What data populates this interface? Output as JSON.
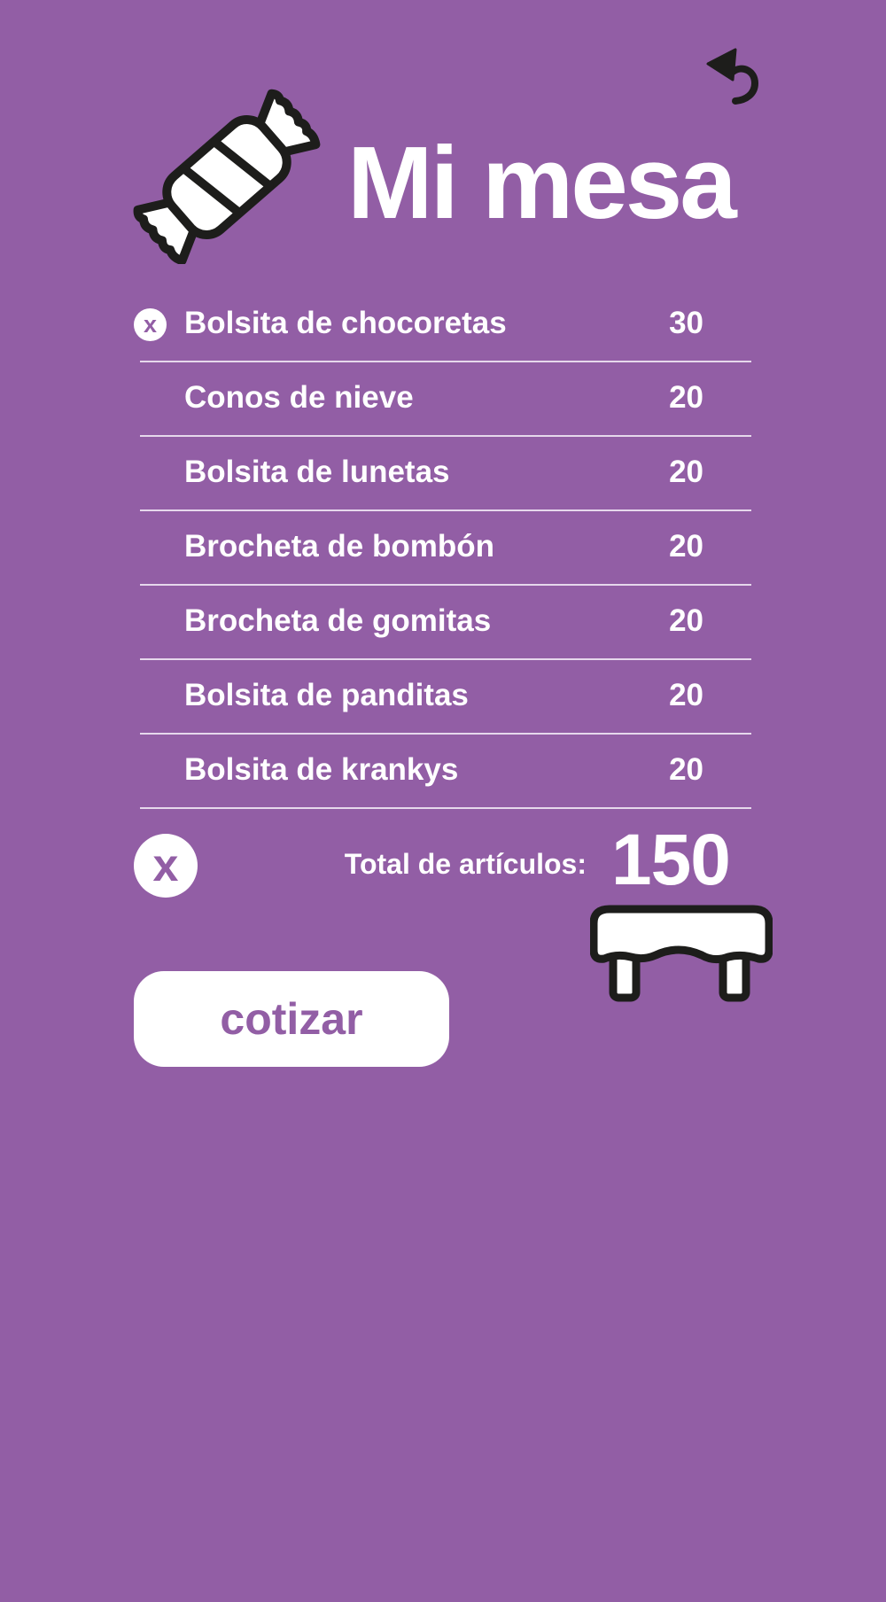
{
  "header": {
    "title": "Mi mesa",
    "logo_icon": "candy-icon",
    "back_icon": "undo-arrow-icon"
  },
  "items": [
    {
      "name": "Bolsita de chocoretas",
      "qty": "30",
      "show_remove": true
    },
    {
      "name": "Conos de nieve",
      "qty": "20",
      "show_remove": false
    },
    {
      "name": "Bolsita de lunetas",
      "qty": "20",
      "show_remove": false
    },
    {
      "name": "Brocheta de bombón",
      "qty": "20",
      "show_remove": false
    },
    {
      "name": "Brocheta de gomitas",
      "qty": "20",
      "show_remove": false
    },
    {
      "name": "Bolsita de panditas",
      "qty": "20",
      "show_remove": false
    },
    {
      "name": "Bolsita de krankys",
      "qty": "20",
      "show_remove": false
    }
  ],
  "summary": {
    "total_label": "Total de artículos:",
    "total_value": "150",
    "clear_glyph": "x",
    "remove_glyph": "x",
    "table_icon": "table-icon"
  },
  "actions": {
    "quote_label": "cotizar"
  },
  "colors": {
    "background": "#925ea5",
    "text": "#ffffff",
    "outline": "#1d1d1b"
  }
}
